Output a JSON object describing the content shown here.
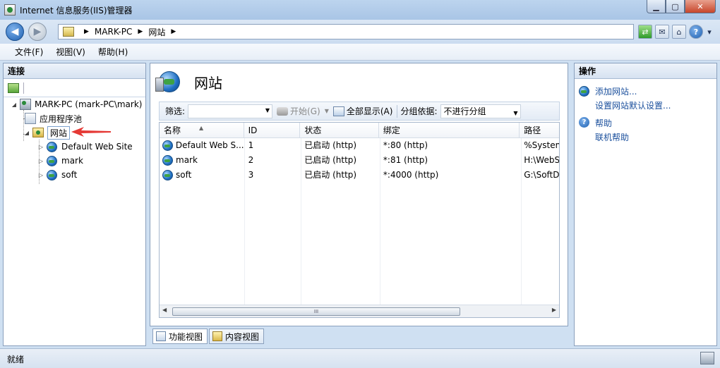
{
  "window": {
    "title": "Internet 信息服务(IIS)管理器"
  },
  "address": {
    "crumbs": [
      "MARK-PC",
      "网站"
    ]
  },
  "menu": [
    "文件(F)",
    "视图(V)",
    "帮助(H)"
  ],
  "connections": {
    "header": "连接",
    "tree": {
      "server": "MARK-PC (mark-PC\\mark)",
      "app_pools": "应用程序池",
      "sites": "网站",
      "site_items": [
        "Default Web Site",
        "mark",
        "soft"
      ]
    }
  },
  "center": {
    "title": "网站",
    "filter": {
      "label": "筛选:",
      "start": "开始(G)",
      "show_all": "全部显示(A)",
      "group_label": "分组依据:",
      "group_value": "不进行分组"
    },
    "table": {
      "columns": [
        "名称",
        "ID",
        "状态",
        "绑定",
        "路径"
      ],
      "rows": [
        [
          "Default Web S...",
          "1",
          "已启动 (http)",
          "*:80 (http)",
          "%System"
        ],
        [
          "mark",
          "2",
          "已启动 (http)",
          "*:81 (http)",
          "H:\\WebS"
        ],
        [
          "soft",
          "3",
          "已启动 (http)",
          "*:4000 (http)",
          "G:\\SoftD"
        ]
      ],
      "scroll_grip": "III"
    },
    "view_tabs": [
      "功能视图",
      "内容视图"
    ]
  },
  "actions": {
    "header": "操作",
    "add_site": "添加网站...",
    "set_defaults": "设置网站默认设置...",
    "help": "帮助",
    "online_help": "联机帮助"
  },
  "status": {
    "text": "就绪"
  },
  "colors": {
    "accent": "#1a4f9c",
    "arrow": "#e53935"
  }
}
